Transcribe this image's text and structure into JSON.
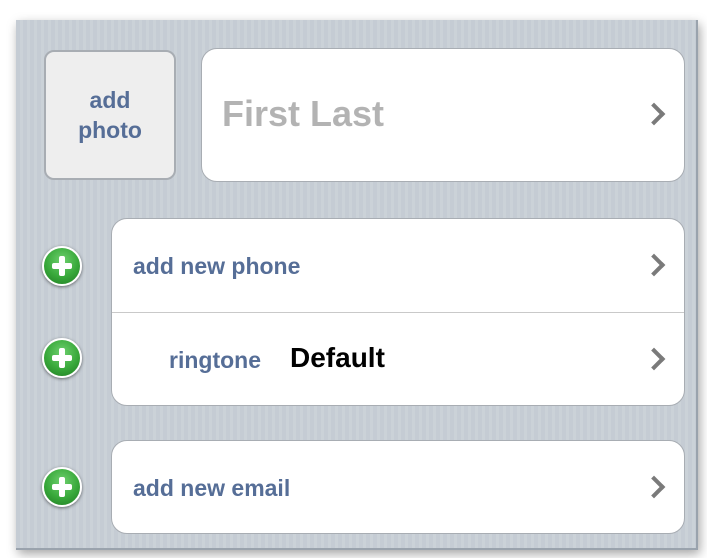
{
  "photo": {
    "label": "add\nphoto"
  },
  "name": {
    "placeholder": "First Last"
  },
  "phone_group": {
    "add_phone_label": "add new phone",
    "ringtone_label": "ringtone",
    "ringtone_value": "Default"
  },
  "email_group": {
    "add_email_label": "add new email"
  },
  "icons": {
    "add": "plus-circle-icon",
    "disclosure": "chevron-right-icon"
  },
  "colors": {
    "label_blue": "#566e97",
    "add_green": "#38a83a",
    "placeholder_gray": "#b3b3b3",
    "background": "#c5ccd4"
  }
}
